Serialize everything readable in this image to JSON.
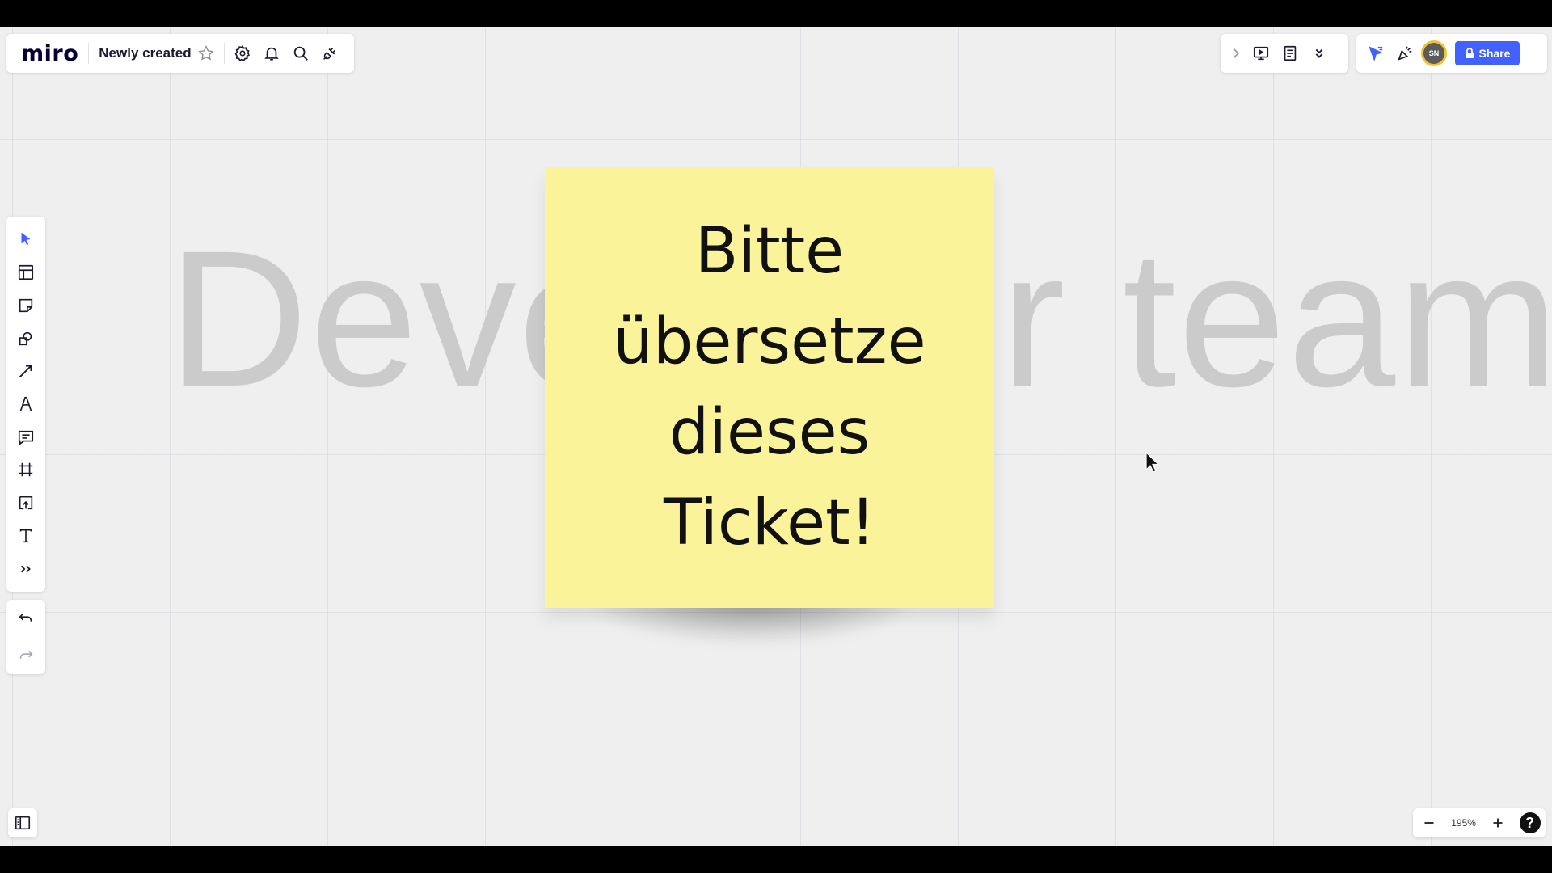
{
  "app": {
    "logo": "miro",
    "board_name": "Newly created"
  },
  "share": {
    "label": "Share"
  },
  "avatar": {
    "initials": "SN"
  },
  "canvas": {
    "background_text": "Developer team",
    "sticky_note": {
      "lines": [
        "Bitte",
        "übersetze",
        "dieses",
        "Ticket!"
      ],
      "color": "#fbf39a"
    }
  },
  "zoom": {
    "level": "195%"
  },
  "help": {
    "label": "?"
  },
  "colors": {
    "accent": "#4262ff",
    "sticky": "#fbf39a",
    "canvas": "#efefef"
  },
  "icons": {
    "top_left": [
      "star-icon",
      "settings-icon",
      "bell-icon",
      "search-icon",
      "integrations-icon"
    ],
    "top_right": [
      "chevron-right-icon",
      "present-icon",
      "notes-icon",
      "chevron-double-down-icon",
      "cursor-filter-icon",
      "celebrate-icon"
    ],
    "toolbar": [
      "select-icon",
      "templates-icon",
      "sticky-note-icon",
      "shapes-icon",
      "connection-line-icon",
      "pen-icon",
      "comment-icon",
      "frame-icon",
      "upload-icon",
      "text-icon",
      "more-tools-icon"
    ],
    "history": [
      "undo-icon",
      "redo-icon"
    ]
  }
}
